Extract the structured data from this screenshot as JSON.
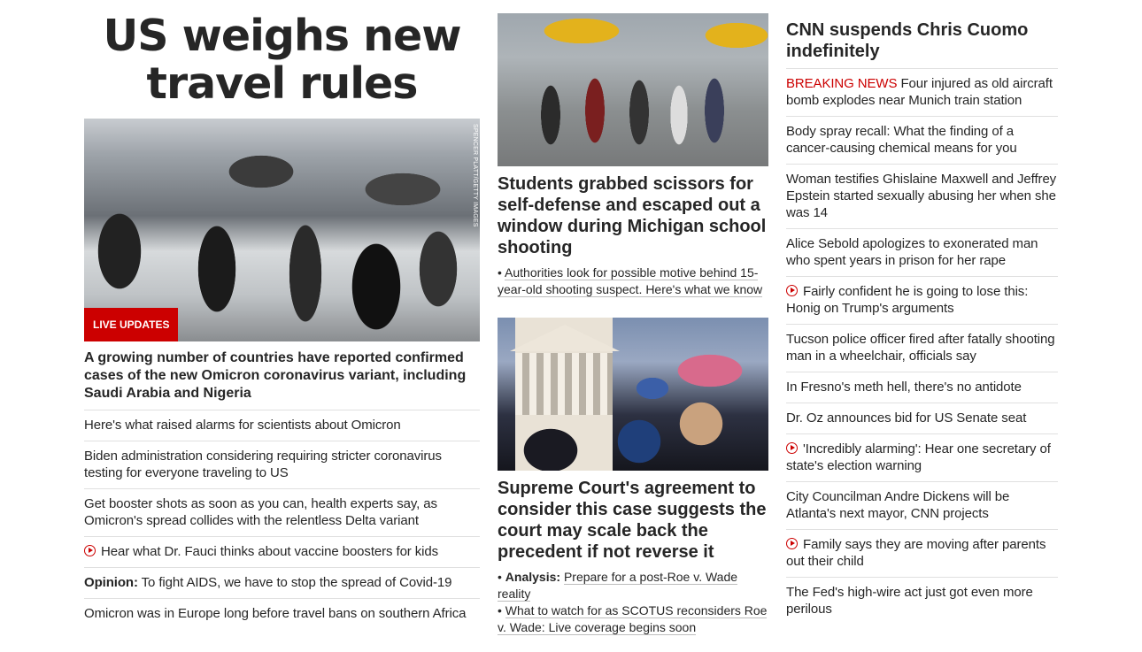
{
  "col1": {
    "headline": "US weighs new travel rules",
    "image_credit": "SPENCER PLATT/GETTY IMAGES",
    "badge": "LIVE UPDATES",
    "description": "A growing number of countries have reported confirmed cases of the new Omicron coronavirus variant, including Saudi Arabia and Nigeria",
    "links": [
      {
        "text": "Here's what raised alarms for scientists about Omicron"
      },
      {
        "text": "Biden administration considering requiring stricter coronavirus testing for everyone traveling to US"
      },
      {
        "text": "Get booster shots as soon as you can, health experts say, as Omicron's spread collides with the relentless Delta variant"
      },
      {
        "text": "Hear what Dr. Fauci thinks about vaccine boosters for kids",
        "icon": "play-icon"
      },
      {
        "prefix": "Opinion:",
        "text": "To fight AIDS, we have to stop the spread of Covid-19"
      },
      {
        "text": "Omicron was in Europe long before travel bans on southern Africa"
      }
    ]
  },
  "col2": {
    "story1": {
      "title": "Students grabbed scissors for self-defense and escaped out a window during Michigan school shooting",
      "sub": [
        "Authorities look for possible motive behind 15-year-old shooting suspect. Here's what we know"
      ]
    },
    "story2": {
      "title": "Supreme Court's agreement to consider this case suggests the court may scale back the precedent if not reverse it",
      "sub_prefix": "Analysis:",
      "sub1": "Prepare for a post-Roe v. Wade reality",
      "sub2": "What to watch for as SCOTUS reconsiders Roe v. Wade: Live coverage begins soon"
    }
  },
  "col3": {
    "title": "CNN suspends Chris Cuomo indefinitely",
    "breaking_label": "BREAKING NEWS",
    "items": [
      {
        "text": "Four injured as old aircraft bomb explodes near Munich train station",
        "breaking": true
      },
      {
        "text": "Body spray recall: What the finding of a cancer-causing chemical means for you"
      },
      {
        "text": "Woman testifies Ghislaine Maxwell and Jeffrey Epstein started sexually abusing her when she was 14"
      },
      {
        "text": "Alice Sebold apologizes to exonerated man who spent years in prison for her rape"
      },
      {
        "text": "Fairly confident he is going to lose this: Honig on Trump's arguments",
        "icon": "play-icon"
      },
      {
        "text": "Tucson police officer fired after fatally shooting man in a wheelchair, officials say"
      },
      {
        "text": "In Fresno's meth hell, there's no antidote"
      },
      {
        "text": "Dr. Oz announces bid for US Senate seat"
      },
      {
        "text": "'Incredibly alarming': Hear one secretary of state's election warning",
        "icon": "play-icon"
      },
      {
        "text": "City Councilman Andre Dickens will be Atlanta's next mayor, CNN projects"
      },
      {
        "text": "Family says they are moving after parents out their child",
        "icon": "play-icon"
      },
      {
        "text": "The Fed's high-wire act just got even more perilous"
      }
    ]
  },
  "colors": {
    "accent": "#cc0000",
    "text": "#262626",
    "divider": "#e0e0e0"
  }
}
